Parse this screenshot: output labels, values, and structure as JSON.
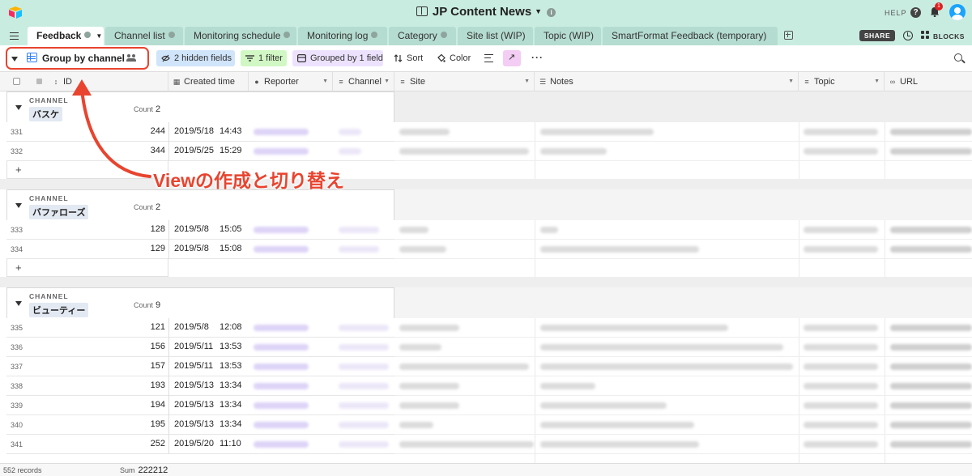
{
  "app": {
    "base_title": "JP Content News",
    "help_label": "HELP",
    "notification_count": "1",
    "share_label": "SHARE",
    "blocks_label": "BLOCKS"
  },
  "tabs": [
    {
      "label": "Feedback",
      "active": true
    },
    {
      "label": "Channel list"
    },
    {
      "label": "Monitoring schedule"
    },
    {
      "label": "Monitoring log"
    },
    {
      "label": "Category"
    },
    {
      "label": "Site list (WIP)"
    },
    {
      "label": "Topic (WIP)"
    },
    {
      "label": "SmartFormat Feedback (temporary)"
    }
  ],
  "toolbar": {
    "view_name": "Group by channel",
    "hidden_fields": "2 hidden fields",
    "filter": "1 filter",
    "grouped": "Grouped by 1 field",
    "sort": "Sort",
    "color": "Color"
  },
  "columns": {
    "id": "ID",
    "created_time": "Created time",
    "reporter": "Reporter",
    "channel": "Channel",
    "site": "Site",
    "notes": "Notes",
    "topic": "Topic",
    "url": "URL"
  },
  "groups": [
    {
      "label": "CHANNEL",
      "value": "バスケ",
      "count_label": "Count",
      "count": "2",
      "rows": [
        {
          "n": "331",
          "id": "244",
          "date": "2019/5/18",
          "time": "14:43"
        },
        {
          "n": "332",
          "id": "344",
          "date": "2019/5/25",
          "time": "15:29"
        }
      ]
    },
    {
      "label": "CHANNEL",
      "value": "バファローズ",
      "count_label": "Count",
      "count": "2",
      "rows": [
        {
          "n": "333",
          "id": "128",
          "date": "2019/5/8",
          "time": "15:05"
        },
        {
          "n": "334",
          "id": "129",
          "date": "2019/5/8",
          "time": "15:08"
        }
      ]
    },
    {
      "label": "CHANNEL",
      "value": "ビューティー",
      "count_label": "Count",
      "count": "9",
      "rows": [
        {
          "n": "335",
          "id": "121",
          "date": "2019/5/8",
          "time": "12:08"
        },
        {
          "n": "336",
          "id": "156",
          "date": "2019/5/11",
          "time": "13:53"
        },
        {
          "n": "337",
          "id": "157",
          "date": "2019/5/11",
          "time": "13:53"
        },
        {
          "n": "338",
          "id": "193",
          "date": "2019/5/13",
          "time": "13:34"
        },
        {
          "n": "339",
          "id": "194",
          "date": "2019/5/13",
          "time": "13:34"
        },
        {
          "n": "340",
          "id": "195",
          "date": "2019/5/13",
          "time": "13:34"
        },
        {
          "n": "341",
          "id": "252",
          "date": "2019/5/20",
          "time": "11:10"
        }
      ]
    }
  ],
  "footer": {
    "records": "552 records",
    "sum_label": "Sum",
    "sum_value": "222212"
  },
  "annotation": {
    "text": "Viewの作成と切り替え"
  },
  "colors": {
    "header_bg": "#c9ece1",
    "annotation_red": "#e8442f",
    "reporter_chip": "#d9cdf7"
  }
}
